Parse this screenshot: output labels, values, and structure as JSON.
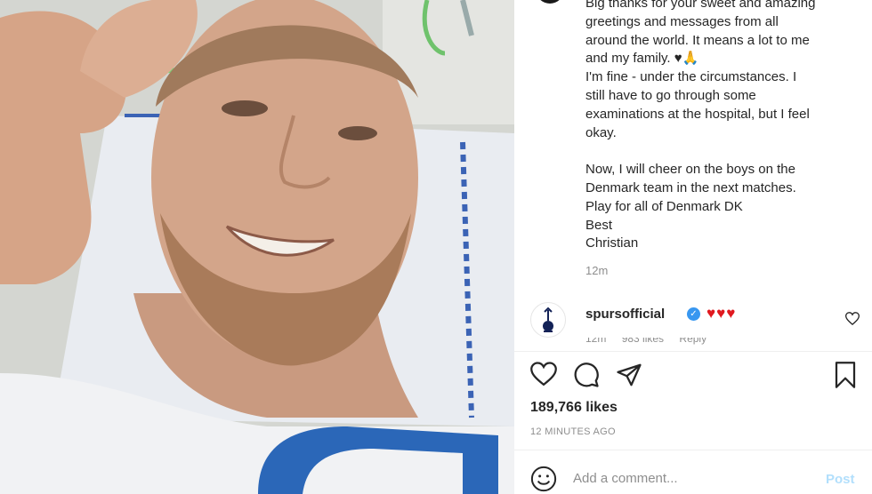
{
  "caption": {
    "lines": [
      "Big thanks for your sweet and amazing",
      "greetings and messages from all",
      "around the world. It means a lot to me",
      "and my family. ♥🙏",
      "I'm fine - under the circumstances. I",
      "still have to go through some",
      "examinations at the hospital, but I feel",
      "okay.",
      "",
      "Now, I will cheer on the boys on the",
      "Denmark team in the next matches.",
      "Play for all of Denmark DK",
      "Best",
      "Christian"
    ],
    "time_ago": "12m"
  },
  "comment": {
    "username": "spursofficial",
    "verified_mark": "✓",
    "hearts": "♥♥♥",
    "meta": [
      "12m",
      "983 likes",
      "Reply"
    ]
  },
  "post": {
    "likes": "189,766 likes",
    "posted_time": "12 MINUTES AGO"
  },
  "comment_box": {
    "placeholder": "Add a comment...",
    "post_label": "Post"
  },
  "icons": {
    "like": "heart-icon",
    "comment": "comment-icon",
    "share": "paper-plane-icon",
    "save": "bookmark-icon",
    "emoji": "smiley-icon",
    "comment_like": "small-heart-icon",
    "club_logo": "cockerel-logo-icon"
  },
  "colors": {
    "text": "#262626",
    "muted": "#8e8e8e",
    "verified": "#3897f0",
    "heart": "#e0191f",
    "post_button": "#b2dffc"
  }
}
